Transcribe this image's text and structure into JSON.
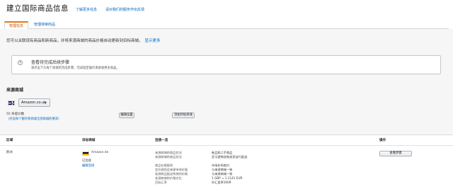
{
  "header": {
    "title": "建立国际商品信息",
    "link1": "了解更多信息",
    "link2": "请对我们的服务作出反馈"
  },
  "tabs": [
    {
      "label": "管理信息",
      "active": true
    },
    {
      "label": "管理待审商品",
      "active": false
    }
  ],
  "intro": {
    "text": "您可以关联现有商品和新商品，并将来源商城的商品价格自动更新到目标商城。",
    "more": "显示更多"
  },
  "alert": {
    "title": "查看待完成后续步骤",
    "body": "请点击下方每个商城的完成步骤，完成指定操作来接收更多商品。"
  },
  "source": {
    "section_title": "来源商城",
    "flag": "uk-flag",
    "marketplace": "Amazon.co.uk",
    "count": "55 条提价数",
    "sublink": "（开设每个额外新商城全部商城的要求）",
    "btn_edit": "编辑设置",
    "btn_add": "添加目标商城"
  },
  "table": {
    "headers": [
      "区域",
      "目标商城",
      "连接一览",
      "操作"
    ],
    "row": {
      "region": "欧洲",
      "flag": "de-flag",
      "marketplace": "Amazon.de",
      "status": "已连接",
      "edit_link": "编辑连接",
      "labels": [
        "来源商城的商品状况",
        "来源商城的商品状况",
        "",
        "商品价格规则",
        "定价规则及来源市场价值",
        "若源商品配送系统的价格",
        "若源商城的价格对比",
        "目标汇率"
      ],
      "values": [
        "新品和二手商品",
        "亚马逊物流和卖家自行配送",
        "",
        "市场价的差价",
        "与来源商城一致",
        "与来源商城一致",
        "1 GBP = 1.1141 EUR",
        "外汇投率1609"
      ],
      "action_btn": "查看步骤"
    }
  },
  "colors": {
    "accent_orange": "#e47911",
    "link_blue": "#0066c0",
    "page_gray": "#f6f6f6"
  }
}
